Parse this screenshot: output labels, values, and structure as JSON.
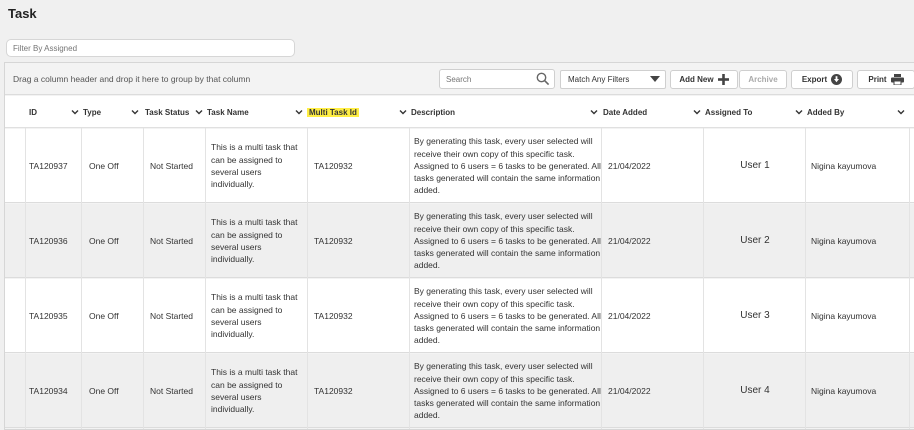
{
  "page": {
    "title": "Task"
  },
  "filter": {
    "placeholder": "Filter By Assigned"
  },
  "toolbar": {
    "group_hint": "Drag a column header and drop it here to group by that column",
    "search_placeholder": "Search",
    "match_value": "Match Any Filters",
    "add_new_label": "Add New",
    "archive_label": "Archive",
    "export_label": "Export",
    "print_label": "Print"
  },
  "columns": [
    {
      "label": "ID"
    },
    {
      "label": "Type"
    },
    {
      "label": "Task Status"
    },
    {
      "label": "Task Name"
    },
    {
      "label": "Multi Task Id",
      "highlight": true
    },
    {
      "label": "Description"
    },
    {
      "label": "Date Added"
    },
    {
      "label": "Assigned To"
    },
    {
      "label": "Added By"
    }
  ],
  "rows": [
    {
      "id": "TA120937",
      "type": "One Off",
      "status": "Not Started",
      "name": "This is a multi task that can be assigned to several users individually.",
      "multi_id": "TA120932",
      "description": "By generating this task, every user selected will receive their own copy of this specific task. Assigned to 6 users = 6 tasks to be generated. All tasks generated will contain the same information added.",
      "date": "21/04/2022",
      "assigned": "User 1",
      "added_by": "Nigina kayumova"
    },
    {
      "id": "TA120936",
      "type": "One Off",
      "status": "Not Started",
      "name": "This is a multi task that can be assigned to several users individually.",
      "multi_id": "TA120932",
      "description": "By generating this task, every user selected will receive their own copy of this specific task. Assigned to 6 users = 6 tasks to be generated. All tasks generated will contain the same information added.",
      "date": "21/04/2022",
      "assigned": "User 2",
      "added_by": "Nigina kayumova"
    },
    {
      "id": "TA120935",
      "type": "One Off",
      "status": "Not Started",
      "name": "This is a multi task that can be assigned to several users individually.",
      "multi_id": "TA120932",
      "description": "By generating this task, every user selected will receive their own copy of this specific task. Assigned to 6 users = 6 tasks to be generated. All tasks generated will contain the same information added.",
      "date": "21/04/2022",
      "assigned": "User 3",
      "added_by": "Nigina kayumova"
    },
    {
      "id": "TA120934",
      "type": "One Off",
      "status": "Not Started",
      "name": "This is a multi task that can be assigned to several users individually.",
      "multi_id": "TA120932",
      "description": "By generating this task, every user selected will receive their own copy of this specific task. Assigned to 6 users = 6 tasks to be generated. All tasks generated will contain the same information added.",
      "date": "21/04/2022",
      "assigned": "User 4",
      "added_by": "Nigina kayumova"
    }
  ],
  "colors": {
    "highlight": "#ffee44",
    "row_alt": "#efefef"
  }
}
